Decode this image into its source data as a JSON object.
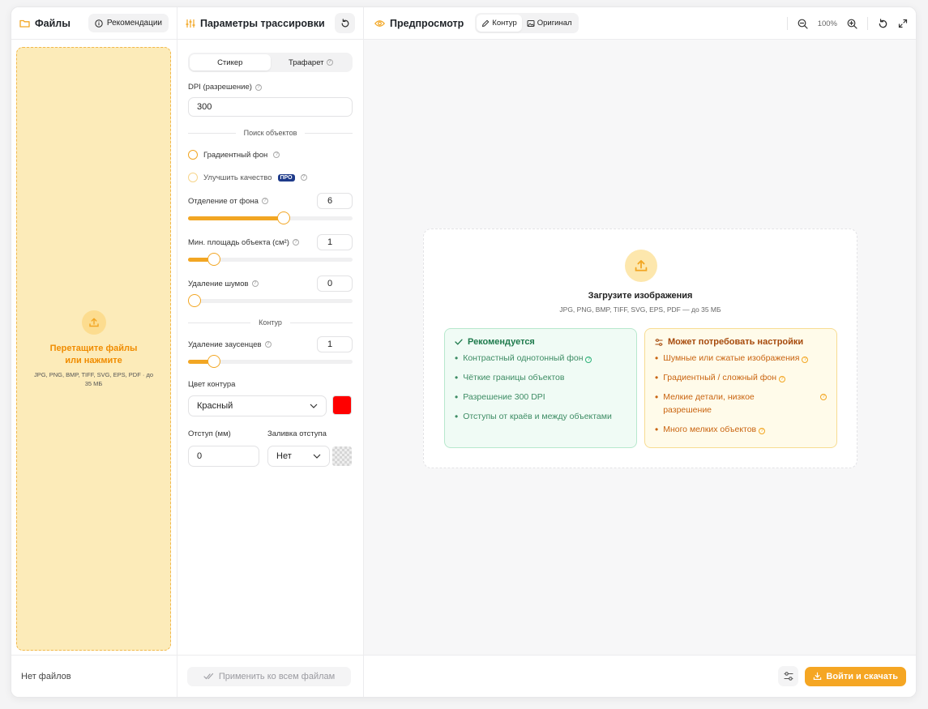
{
  "files": {
    "title": "Файлы",
    "recommendations_label": "Рекомендации",
    "drop_title": "Перетащите файлы или нажмите",
    "drop_sub": "JPG, PNG, BMP, TIFF, SVG, EPS, PDF · до 35 МБ",
    "empty_status": "Нет файлов"
  },
  "params": {
    "title": "Параметры трассировки",
    "mode_tabs": [
      "Стикер",
      "Трафарет"
    ],
    "active_mode": "Стикер",
    "dpi_label": "DPI (разрешение)",
    "dpi_value": "300",
    "section_objects": "Поиск объектов",
    "gradient_bg_label": "Градиентный фон",
    "improve_quality_label": "Улучшить качество",
    "pro_badge": "ПРО",
    "bg_separation": {
      "label": "Отделение от фона",
      "value": "6",
      "fraction": 0.59
    },
    "min_area": {
      "label": "Мин. площадь объекта (см²)",
      "value": "1",
      "fraction": 0.13
    },
    "noise_removal": {
      "label": "Удаление шумов",
      "value": "0",
      "fraction": 0.0
    },
    "section_contour": "Контур",
    "burr_removal": {
      "label": "Удаление заусенцев",
      "value": "1",
      "fraction": 0.13
    },
    "contour_color_label": "Цвет контура",
    "contour_color_value": "Красный",
    "contour_color_hex": "#ff0000",
    "offset_label": "Отступ (мм)",
    "offset_value": "0",
    "offset_fill_label": "Заливка отступа",
    "offset_fill_value": "Нет",
    "apply_all_label": "Применить ко всем файлам"
  },
  "preview": {
    "title": "Предпросмотр",
    "tabs": [
      "Контур",
      "Оригинал"
    ],
    "zoom": "100%",
    "upload_title": "Загрузите изображения",
    "upload_sub": "JPG, PNG, BMP, TIFF, SVG, EPS, PDF — до 35 МБ",
    "recommended_title": "Рекомендуется",
    "recommended_items": [
      "Контрастный однотонный фон",
      "Чёткие границы объектов",
      "Разрешение 300 DPI",
      "Отступы от краёв и между объектами"
    ],
    "tuning_title": "Может потребовать настройки",
    "tuning_items": [
      "Шумные или сжатые изображения",
      "Градиентный / сложный фон",
      "Мелкие детали, низкое разрешение",
      "Много мелких объектов"
    ],
    "login_download_label": "Войти и скачать"
  },
  "colors": {
    "accent": "#f5a623",
    "success": "#2fb37a",
    "warning": "#f2a623",
    "pro": "#1e3a8a"
  }
}
